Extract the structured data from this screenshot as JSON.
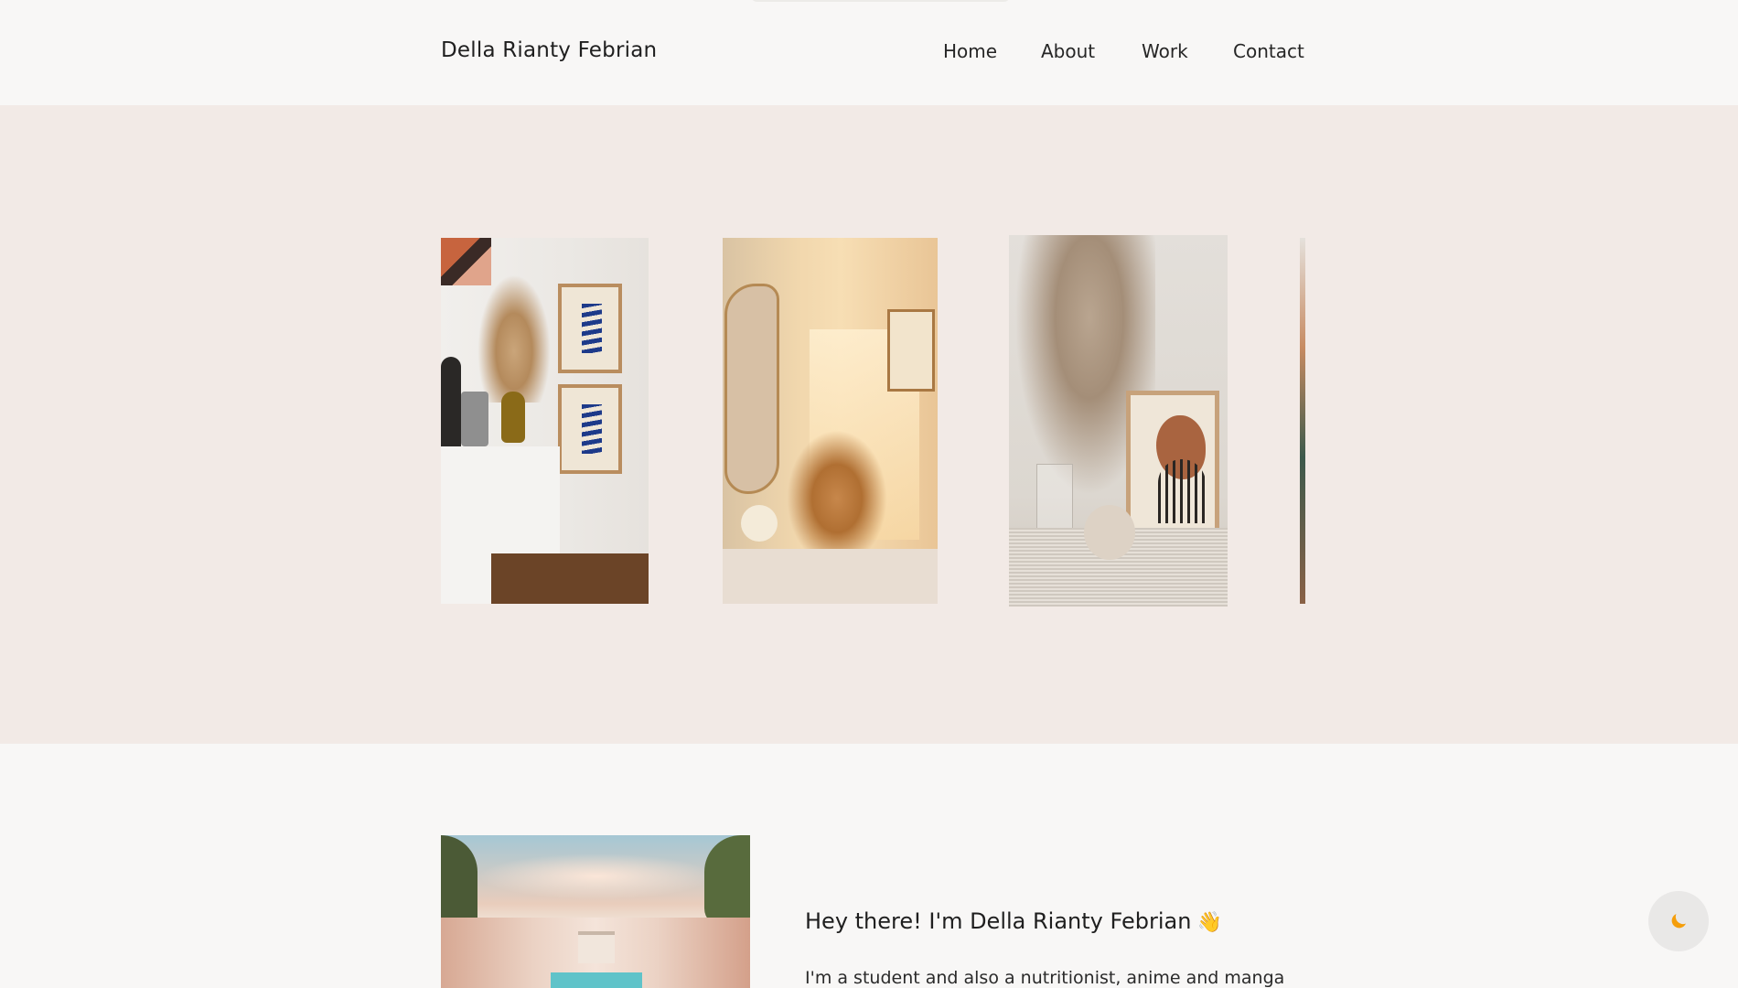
{
  "header": {
    "brand": "Della Rianty Febrian",
    "nav": [
      "Home",
      "About",
      "Work",
      "Contact"
    ]
  },
  "gallery": {
    "photos": [
      "shelf-with-pampas-and-prints",
      "sunlit-wall-with-mirror",
      "pampas-and-vase-with-print",
      "partial-photo"
    ]
  },
  "about": {
    "title": "Hey there! I'm Della Rianty Febrian",
    "emoji": "👋",
    "text": "I'm a student and also a nutritionist, anime and manga"
  },
  "theme_toggle": {
    "icon": "moon-icon"
  },
  "colors": {
    "background": "#f8f7f6",
    "hero_background": "#f2eae6",
    "moon": "#f59e0b"
  }
}
